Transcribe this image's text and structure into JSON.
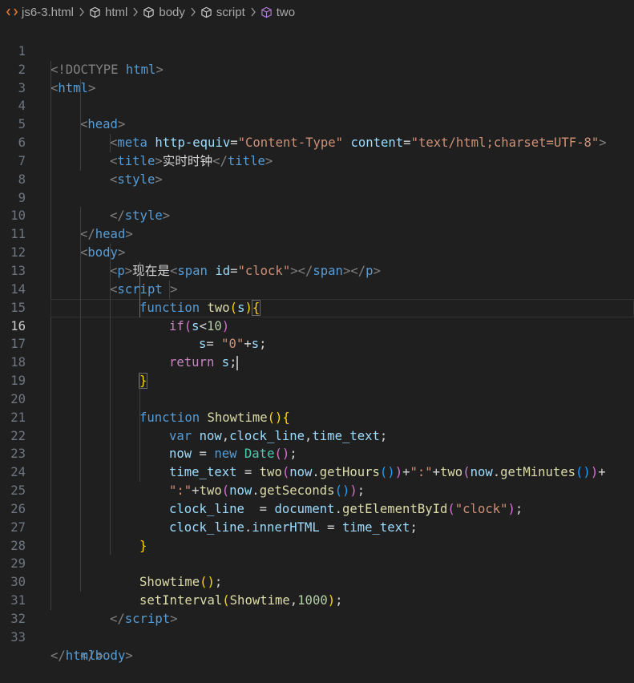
{
  "breadcrumb": {
    "file": "js6-3.html",
    "items": [
      "html",
      "body",
      "script",
      "two"
    ]
  },
  "editor": {
    "current_line": 16,
    "line_numbers": [
      "1",
      "2",
      "3",
      "4",
      "5",
      "6",
      "7",
      "8",
      "9",
      "10",
      "11",
      "12",
      "13",
      "14",
      "15",
      "16",
      "17",
      "18",
      "19",
      "20",
      "21",
      "22",
      "23",
      "24",
      "25",
      "26",
      "27",
      "28",
      "29",
      "30",
      "31",
      "32",
      "33"
    ],
    "code": {
      "l1": [
        "<!DOCTYPE ",
        "html",
        ">"
      ],
      "l2": [
        "<",
        "html",
        ">"
      ],
      "l3": [
        "<",
        "head",
        ">"
      ],
      "l4": [
        "<",
        "meta",
        " ",
        "http-equiv",
        "=",
        "\"Content-Type\"",
        " ",
        "content",
        "=",
        "\"text/html;charset=UTF-8\"",
        ">"
      ],
      "l5": [
        "<",
        "title",
        ">",
        "实时时钟",
        "</",
        "title",
        ">"
      ],
      "l6": [
        "<",
        "style",
        ">"
      ],
      "l8": [
        "</",
        "style",
        ">"
      ],
      "l9": [
        "</",
        "head",
        ">"
      ],
      "l10": [
        "<",
        "body",
        ">"
      ],
      "l11": [
        "<",
        "p",
        ">",
        "现在是",
        "<",
        "span",
        " ",
        "id",
        "=",
        "\"clock\"",
        ">",
        "</",
        "span",
        ">",
        "</",
        "p",
        ">"
      ],
      "l12": [
        "<",
        "script",
        " >"
      ],
      "l13": [
        "function",
        " ",
        "two",
        "(",
        "s",
        ")",
        "{"
      ],
      "l14": [
        "if",
        "(",
        "s",
        "<",
        "10",
        ")"
      ],
      "l15": [
        "s",
        "= ",
        "\"0\"",
        "+",
        "s",
        ";"
      ],
      "l16": [
        "return",
        " ",
        "s",
        ";"
      ],
      "l17": [
        "}"
      ],
      "l19": [
        "function",
        " ",
        "Showtime",
        "()",
        "{"
      ],
      "l20": [
        "var",
        " ",
        "now",
        ",",
        "clock_line",
        ",",
        "time_text",
        ";"
      ],
      "l21": [
        "now",
        " = ",
        "new",
        " ",
        "Date",
        "()",
        ";"
      ],
      "l22": [
        "time_text",
        " = ",
        "two",
        "(",
        "now",
        ".",
        "getHours",
        "()",
        ")",
        "+",
        "\":\"",
        "+",
        "two",
        "(",
        "now",
        ".",
        "getMinutes",
        "()",
        ")",
        "+"
      ],
      "l23": [
        "\":\"",
        "+",
        "two",
        "(",
        "now",
        ".",
        "getSeconds",
        "()",
        ")",
        ";"
      ],
      "l24": [
        "clock_line",
        "  = ",
        "document",
        ".",
        "getElementById",
        "(",
        "\"clock\"",
        ")",
        ";"
      ],
      "l25": [
        "clock_line",
        ".",
        "innerHTML",
        " = ",
        "time_text",
        ";"
      ],
      "l26": [
        "}"
      ],
      "l28": [
        "Showtime",
        "()",
        ";"
      ],
      "l29": [
        "setInterval",
        "(",
        "Showtime",
        ",",
        "1000",
        ")",
        ";"
      ],
      "l30": [
        "</",
        "script",
        ">"
      ],
      "l32": [
        "</",
        "body",
        ">"
      ],
      "l33": [
        "</",
        "html",
        ">"
      ]
    }
  },
  "colors": {
    "background": "#1f1f1f",
    "tag": "#569cd6",
    "attribute": "#9cdcfe",
    "string": "#ce9178",
    "function": "#dcdcaa",
    "control": "#c586c0",
    "number": "#b5cea8",
    "class": "#4ec9b0"
  }
}
